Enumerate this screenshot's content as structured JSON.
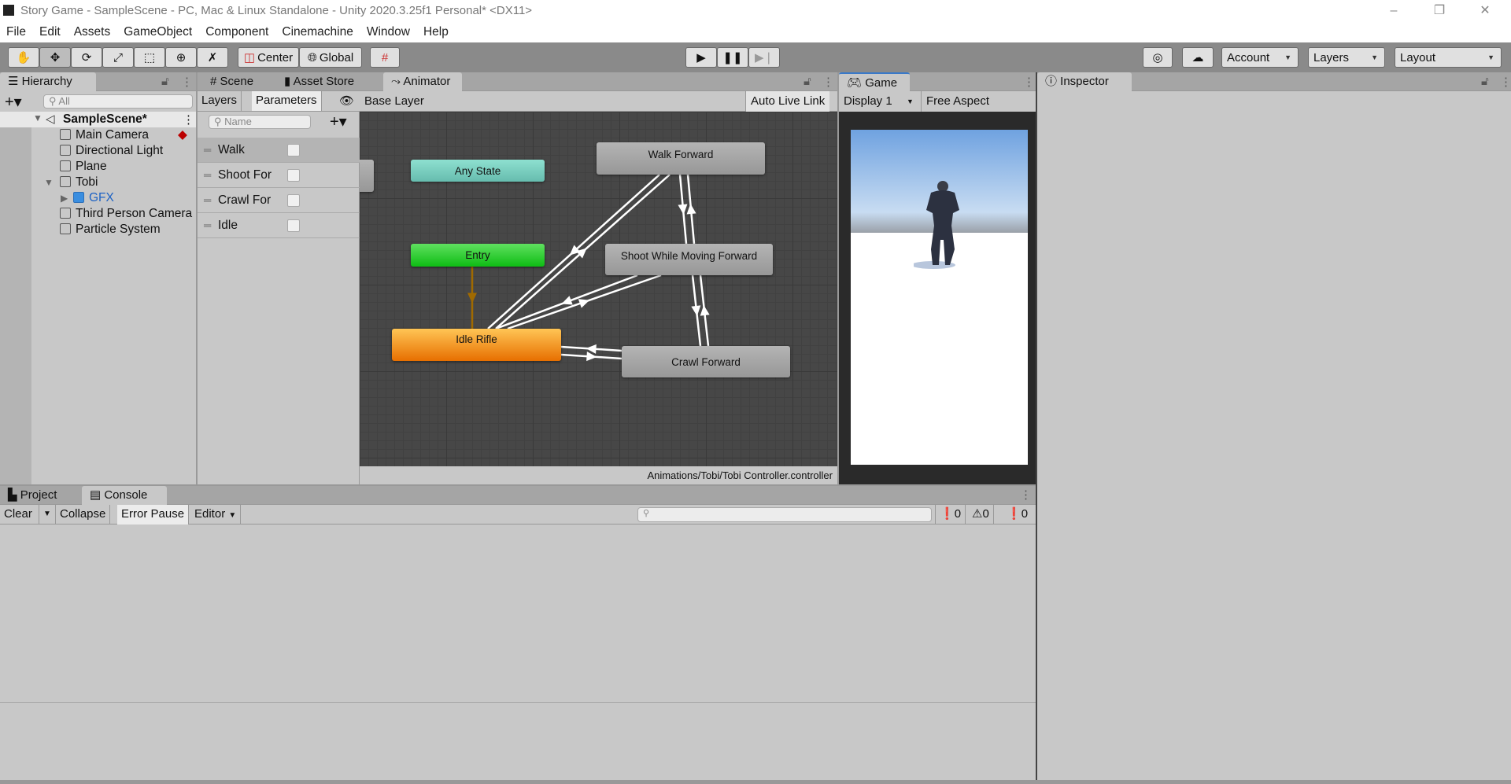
{
  "window": {
    "title": "Story Game - SampleScene - PC, Mac & Linux Standalone - Unity 2020.3.25f1 Personal* <DX11>",
    "minimize": "–",
    "restore": "❐",
    "close": "✕"
  },
  "menu": [
    "File",
    "Edit",
    "Assets",
    "GameObject",
    "Component",
    "Cinemachine",
    "Window",
    "Help"
  ],
  "toolbar": {
    "center": "Center",
    "global": "Global",
    "account": "Account",
    "layers": "Layers",
    "layout": "Layout",
    "tools": [
      "hand-tool",
      "move-tool",
      "rotate-tool",
      "scale-tool",
      "rect-tool",
      "transform-tool",
      "custom-tool"
    ]
  },
  "hierarchy": {
    "tab": "Hierarchy",
    "search_placeholder": "All",
    "scene": "SampleScene*",
    "items": [
      {
        "label": "Main Camera",
        "depth": 1
      },
      {
        "label": "Directional Light",
        "depth": 1
      },
      {
        "label": "Plane",
        "depth": 1
      },
      {
        "label": "Tobi",
        "depth": 1,
        "expanded": true
      },
      {
        "label": "GFX",
        "depth": 2,
        "prefab": true
      },
      {
        "label": "Third Person Camera",
        "depth": 1
      },
      {
        "label": "Particle System",
        "depth": 1
      }
    ]
  },
  "center_tabs": {
    "scene": "Scene",
    "asset_store": "Asset Store",
    "animator": "Animator"
  },
  "animator": {
    "layers_tab": "Layers",
    "parameters_tab": "Parameters",
    "breadcrumb": "Base Layer",
    "auto_live_link": "Auto Live Link",
    "search_placeholder": "Name",
    "parameters": [
      {
        "name": "Walk",
        "value": false
      },
      {
        "name": "Shoot For",
        "value": false
      },
      {
        "name": "Crawl For",
        "value": false
      },
      {
        "name": "Idle",
        "value": false
      }
    ],
    "states": {
      "any": "Any State",
      "entry": "Entry",
      "idle": "Idle Rifle",
      "walk": "Walk Forward",
      "shoot": "Shoot While Moving Forward",
      "crawl": "Crawl Forward"
    },
    "transitions": [
      {
        "from": "Entry",
        "to": "Idle Rifle"
      },
      {
        "from": "Idle Rifle",
        "to": "Walk Forward"
      },
      {
        "from": "Walk Forward",
        "to": "Idle Rifle"
      },
      {
        "from": "Idle Rifle",
        "to": "Shoot While Moving Forward"
      },
      {
        "from": "Shoot While Moving Forward",
        "to": "Idle Rifle"
      },
      {
        "from": "Walk Forward",
        "to": "Shoot While Moving Forward"
      },
      {
        "from": "Shoot While Moving Forward",
        "to": "Walk Forward"
      },
      {
        "from": "Shoot While Moving Forward",
        "to": "Crawl Forward"
      },
      {
        "from": "Crawl Forward",
        "to": "Shoot While Moving Forward"
      },
      {
        "from": "Crawl Forward",
        "to": "Idle Rifle"
      },
      {
        "from": "Idle Rifle",
        "to": "Crawl Forward"
      }
    ],
    "path": "Animations/Tobi/Tobi Controller.controller",
    "colors": {
      "any": "#7fd4c4",
      "entry": "#22c22a",
      "default": "#f39a1c",
      "state": "#a8a8a8",
      "default_transition": "#a06a00"
    }
  },
  "game": {
    "tab": "Game",
    "display": "Display 1",
    "aspect": "Free Aspect"
  },
  "inspector": {
    "tab": "Inspector"
  },
  "bottom": {
    "project_tab": "Project",
    "console_tab": "Console",
    "clear": "Clear",
    "collapse": "Collapse",
    "error_pause": "Error Pause",
    "editor": "Editor",
    "errors": "0",
    "warnings": "0",
    "messages": "0"
  }
}
